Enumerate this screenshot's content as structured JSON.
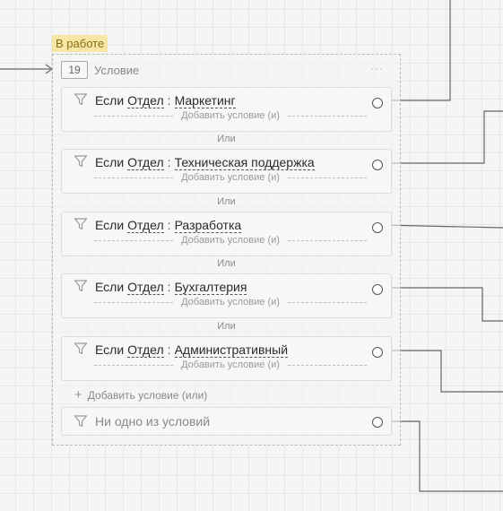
{
  "node": {
    "status_tag": "В работе",
    "id": "19",
    "title": "Условие",
    "menu": "···",
    "conditions": [
      {
        "keyword": "Если",
        "field": "Отдел",
        "separator": ":",
        "value": "Маркетинг",
        "add_and": "Добавить условие (и)"
      },
      {
        "keyword": "Если",
        "field": "Отдел",
        "separator": ":",
        "value": "Техническая поддержка",
        "add_and": "Добавить условие (и)"
      },
      {
        "keyword": "Если",
        "field": "Отдел",
        "separator": ":",
        "value": "Разработка",
        "add_and": "Добавить условие (и)"
      },
      {
        "keyword": "Если",
        "field": "Отдел",
        "separator": ":",
        "value": "Бухгалтерия",
        "add_and": "Добавить условие (и)"
      },
      {
        "keyword": "Если",
        "field": "Отдел",
        "separator": ":",
        "value": "Административный",
        "add_and": "Добавить условие (и)"
      }
    ],
    "or_labels": [
      "Или",
      "Или",
      "Или",
      "Или"
    ],
    "add_or": {
      "icon": "plus-icon",
      "label": "Добавить условие (или)"
    },
    "none_of": {
      "icon": "filter-icon",
      "label": "Ни одно из условий"
    }
  },
  "colors": {
    "canvas": "#f5f5f5",
    "grid": "#e6e6e6",
    "status_tag_bg": "#f6e7a6",
    "status_tag_text": "#8a6d17",
    "wire": "#666666"
  }
}
